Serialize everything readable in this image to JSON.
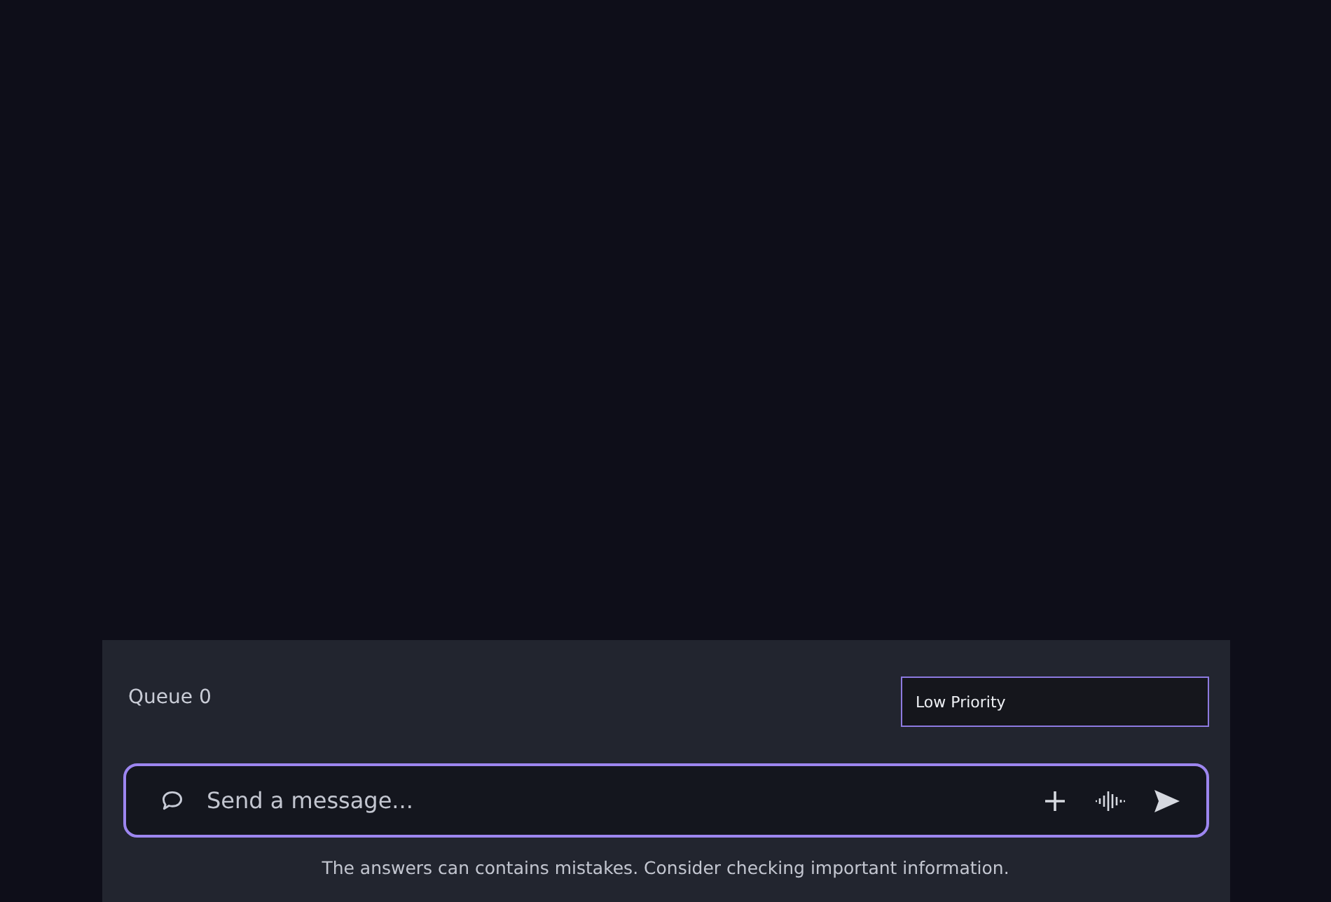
{
  "queue": {
    "label": "Queue 0"
  },
  "priority": {
    "value": "Low Priority"
  },
  "composer": {
    "placeholder": "Send a message..."
  },
  "disclaimer": "The answers can contains mistakes. Consider checking important information."
}
